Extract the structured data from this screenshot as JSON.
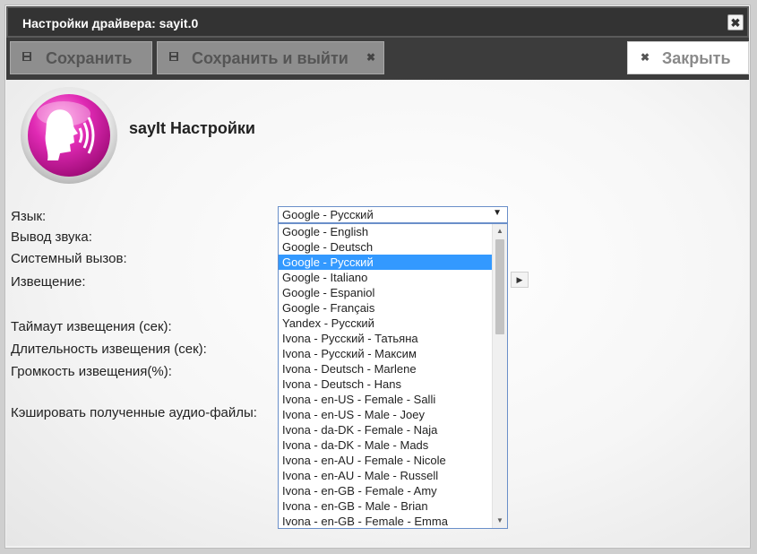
{
  "window": {
    "title": "Настройки драйвера: sayit.0",
    "close_glyph": "✖"
  },
  "toolbar": {
    "save_label": "Сохранить",
    "save_exit_label": "Сохранить и выйти",
    "close_label": "Закрыть",
    "save_icon": "floppy-icon",
    "close_icon": "x-icon"
  },
  "header": {
    "title": "sayIt Настройки",
    "logo_icon": "speaking-head-icon",
    "logo_color": "#d4189e"
  },
  "form": {
    "labels": [
      "Язык:",
      "Вывод звука:",
      "Системный вызов:",
      "Извещение:",
      "Таймаут извещения (сек):",
      "Длительность извещения (сек):",
      "Громкость извещения(%):",
      "Кэшировать полученные аудио-файлы:"
    ],
    "language_select": {
      "value": "Google - Русский",
      "options": [
        "Google - English",
        "Google - Deutsch",
        "Google - Русский",
        "Google - Italiano",
        "Google - Espaniol",
        "Google - Français",
        "Yandex - Русский",
        "Ivona - Русский - Татьяна",
        "Ivona - Русский - Максим",
        "Ivona - Deutsch - Marlene",
        "Ivona - Deutsch - Hans",
        "Ivona - en-US - Female - Salli",
        "Ivona - en-US - Male - Joey",
        "Ivona - da-DK - Female - Naja",
        "Ivona - da-DK - Male - Mads",
        "Ivona - en-AU - Female - Nicole",
        "Ivona - en-AU - Male - Russell",
        "Ivona - en-GB - Female - Amy",
        "Ivona - en-GB - Male - Brian",
        "Ivona - en-GB - Female - Emma"
      ],
      "selected_index": 2
    },
    "play_button_icon": "play-icon"
  },
  "colors": {
    "selected_option": "#3399ff",
    "titlebar": "#333333"
  }
}
